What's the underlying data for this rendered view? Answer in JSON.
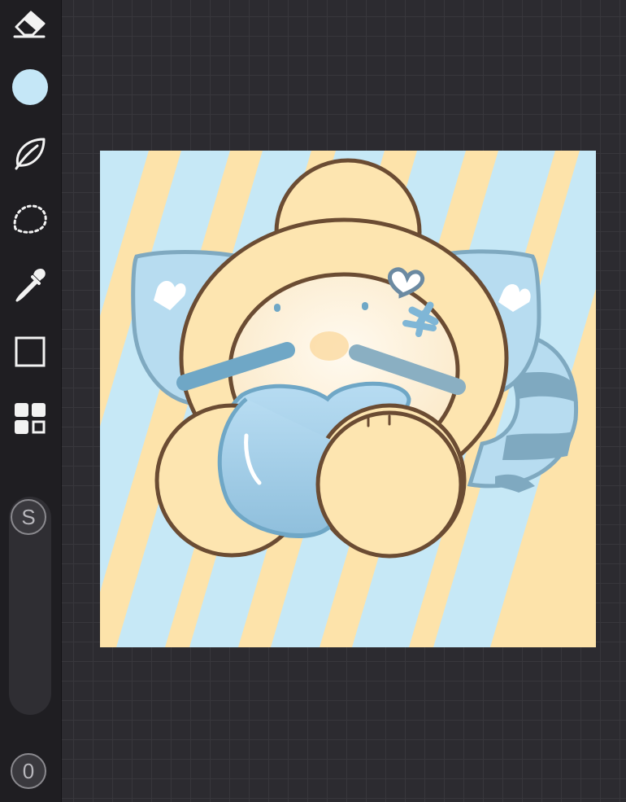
{
  "app": {
    "tools": [
      {
        "name": "eraser-icon"
      },
      {
        "name": "color-swatch",
        "color": "#c5e7f7"
      },
      {
        "name": "leaf-icon"
      },
      {
        "name": "lasso-selection-icon"
      },
      {
        "name": "eyedropper-icon"
      },
      {
        "name": "square-icon"
      },
      {
        "name": "layout-grid-icon"
      }
    ],
    "size_badge": "S",
    "opacity_badge": "0"
  },
  "canvas": {
    "colors": {
      "stripe_yellow": "#fde3aa",
      "stripe_blue": "#c6e8f6",
      "body_yellow": "#fde5b0",
      "face_cream": "#fdf5e4",
      "outline": "#6b4c33",
      "blue_dark": "#7fa9c0",
      "blue_light": "#b7dcf0"
    }
  }
}
